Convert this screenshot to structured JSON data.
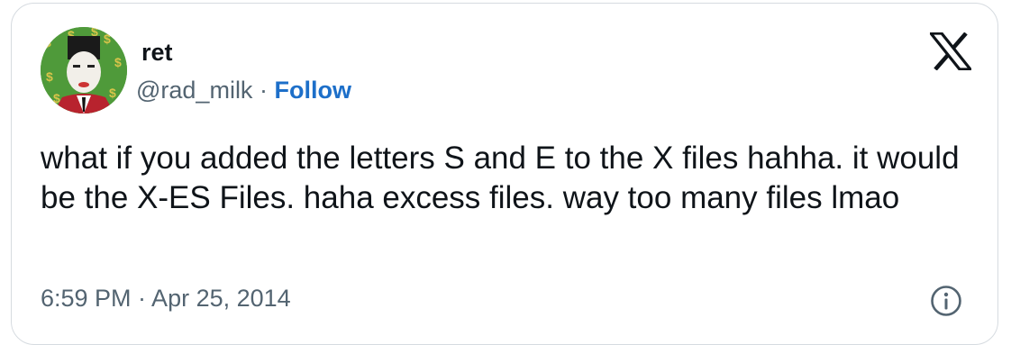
{
  "author": {
    "display_name": "ret",
    "handle": "@rad_milk",
    "separator": "·",
    "follow_label": "Follow"
  },
  "tweet": {
    "text": "what if you added the letters S and E to the X files hahha. it would be the X-ES Files. haha excess files. way too many files lmao",
    "timestamp": "6:59 PM · Apr 25, 2014"
  },
  "icons": {
    "logo": "x-logo-icon",
    "info": "info-icon"
  },
  "colors": {
    "text": "#0f1419",
    "secondary": "#536471",
    "follow": "#1d6fc9",
    "border": "#d6dbe0",
    "avatar_bg": "#4f9a3a"
  }
}
